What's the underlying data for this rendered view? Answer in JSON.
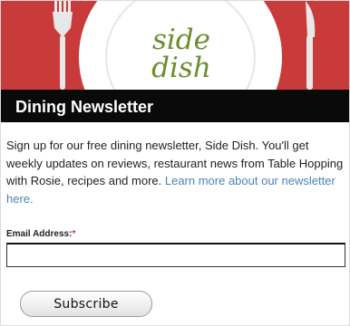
{
  "banner": {
    "logo_line1": "side",
    "logo_line2": "dish",
    "logo_color": "#6b8f2c",
    "background_color": "#c93a3a",
    "plate_color": "#ffffff",
    "icons": [
      "fork-icon",
      "plate-icon",
      "knife-icon"
    ]
  },
  "title": "Dining Newsletter",
  "intro": {
    "text": "Sign up for our free dining newsletter, Side Dish. You'll get weekly updates on reviews, restaurant news from Table Hopping with Rosie, recipes and more.  ",
    "link_text": "Learn more about our newsletter here.",
    "link_color": "#4a83b8"
  },
  "form": {
    "email_label": "Email Address:",
    "required_marker": "*",
    "required_color": "#d0342c",
    "email_value": "",
    "subscribe_label": "Subscribe"
  }
}
